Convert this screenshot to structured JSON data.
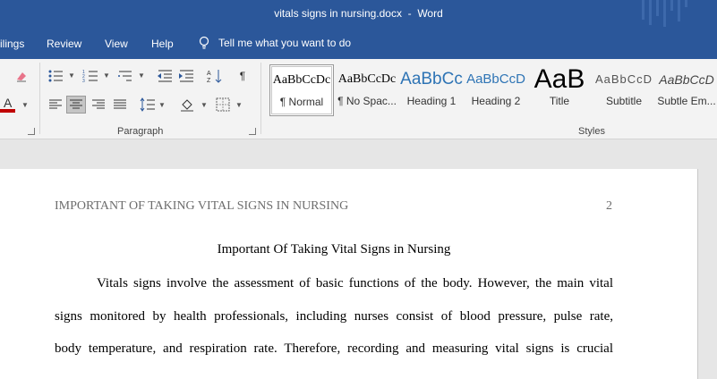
{
  "window": {
    "doc_name": "vitals signs in nursing.docx",
    "separator": "-",
    "app_name": "Word"
  },
  "menu": {
    "tabs": [
      "ilings",
      "Review",
      "View",
      "Help"
    ],
    "tell_me": "Tell me what you want to do"
  },
  "ribbon": {
    "paragraph_label": "Paragraph",
    "styles_label": "Styles",
    "styles": [
      {
        "sample": "AaBbCcDc",
        "name": "¶ Normal"
      },
      {
        "sample": "AaBbCcDc",
        "name": "¶ No Spac..."
      },
      {
        "sample": "AaBbCc",
        "name": "Heading 1"
      },
      {
        "sample": "AaBbCcD",
        "name": "Heading 2"
      },
      {
        "sample": "AaB",
        "name": "Title"
      },
      {
        "sample": "AaBbCcD",
        "name": "Subtitle"
      },
      {
        "sample": "AaBbCcD",
        "name": "Subtle Em..."
      }
    ],
    "colors": {
      "font_color": "#c00000",
      "title_blue": "#2b579a",
      "heading_blue": "#2e74b5"
    }
  },
  "document": {
    "header_text": "IMPORTANT OF TAKING VITAL SIGNS IN NURSING",
    "page_number": "2",
    "title": "Important Of Taking Vital Signs in Nursing",
    "lines": [
      "Vitals signs involve the assessment of basic functions of the body. However, the main vital",
      "signs monitored by health professionals, including nurses consist of blood pressure, pulse rate,",
      "body temperature, and respiration rate. Therefore, recording and measuring vital signs is crucial"
    ]
  }
}
